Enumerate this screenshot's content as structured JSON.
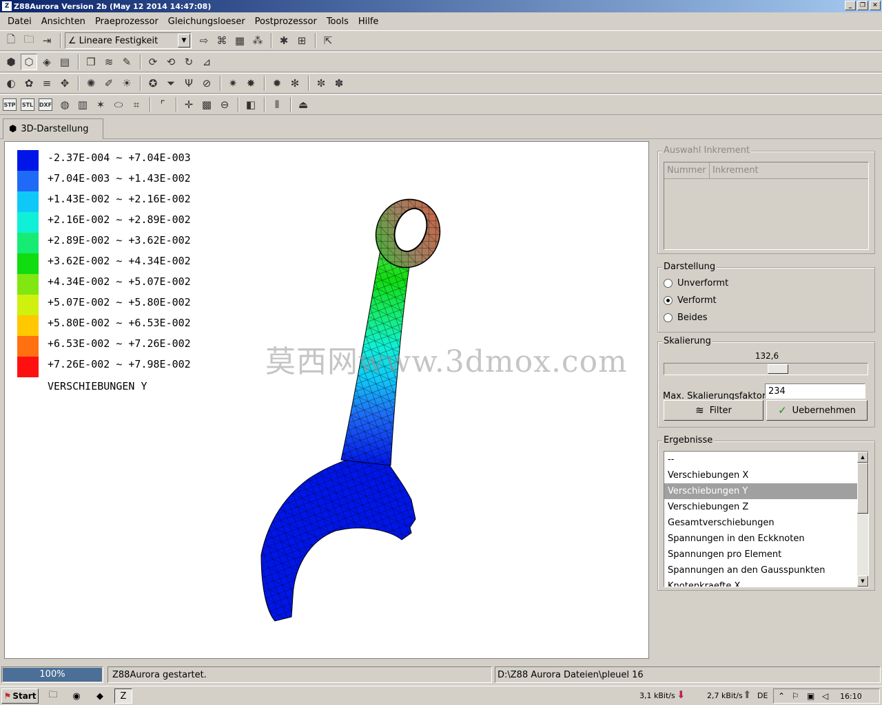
{
  "window": {
    "title": "Z88Aurora Version 2b (May 12 2014 14:47:08)",
    "app_icon": "Z",
    "minimize_glyph": "_",
    "restore_glyph": "❐",
    "close_glyph": "✕"
  },
  "menu": [
    "Datei",
    "Ansichten",
    "Praeprozessor",
    "Gleichungsloeser",
    "Postprozessor",
    "Tools",
    "Hilfe"
  ],
  "toolbar": {
    "analysis_type": "Lineare Festigkeit",
    "analysis_icon": "∠",
    "row1_left": [
      {
        "name": "new-file-icon",
        "glyph": "🗋"
      },
      {
        "name": "open-folder-icon",
        "glyph": "🗀"
      },
      {
        "name": "import-icon",
        "glyph": "⇥"
      }
    ],
    "row1_right": [
      {
        "name": "arrow-right-icon",
        "glyph": "⇨"
      },
      {
        "name": "mesh-icon",
        "glyph": "⌘"
      },
      {
        "name": "table-icon",
        "glyph": "▦"
      },
      {
        "name": "nodes-icon",
        "glyph": "⁂"
      },
      {
        "name": "bug-icon",
        "glyph": "✱"
      },
      {
        "name": "add-icon",
        "glyph": "⊞"
      },
      {
        "name": "exit-icon",
        "glyph": "⇱"
      }
    ],
    "row2": [
      {
        "name": "solid-view-icon",
        "glyph": "⬢"
      },
      {
        "name": "solid-mesh-view-icon",
        "glyph": "⬡",
        "active": true
      },
      {
        "name": "wireframe-view-icon",
        "glyph": "◈"
      },
      {
        "name": "surface-view-icon",
        "glyph": "▤"
      },
      {
        "name": "cube-icon",
        "glyph": "❒"
      },
      {
        "name": "layers-icon",
        "glyph": "≋"
      },
      {
        "name": "paint-icon",
        "glyph": "✎"
      },
      {
        "name": "rotate-x-icon",
        "glyph": "⟳"
      },
      {
        "name": "rotate-y-icon",
        "glyph": "⟲"
      },
      {
        "name": "rotate-z-icon",
        "glyph": "↻"
      },
      {
        "name": "axis-icon",
        "glyph": "⊿"
      }
    ],
    "row3": [
      {
        "name": "lighting-icon",
        "glyph": "◐"
      },
      {
        "name": "color-icon",
        "glyph": "✿"
      },
      {
        "name": "shading-icon",
        "glyph": "≡"
      },
      {
        "name": "move-icon",
        "glyph": "✥"
      },
      {
        "name": "materials-icon",
        "glyph": "✺"
      },
      {
        "name": "notes-icon",
        "glyph": "✐"
      },
      {
        "name": "light-bulb-icon",
        "glyph": "☀"
      },
      {
        "name": "constraints-icon",
        "glyph": "✪"
      },
      {
        "name": "filter-funnel-icon",
        "glyph": "⏷"
      },
      {
        "name": "branch-icon",
        "glyph": "Ψ"
      },
      {
        "name": "no-entry-icon",
        "glyph": "⊘"
      },
      {
        "name": "forces-icon",
        "glyph": "✷"
      },
      {
        "name": "pressure-icon",
        "glyph": "✸"
      },
      {
        "name": "loads-icon",
        "glyph": "✹"
      },
      {
        "name": "supports-icon",
        "glyph": "✻"
      },
      {
        "name": "springs-icon",
        "glyph": "✼"
      },
      {
        "name": "contacts-icon",
        "glyph": "✽"
      }
    ],
    "row4": [
      {
        "name": "import-stp-icon",
        "glyph": "STP"
      },
      {
        "name": "import-stl-icon",
        "glyph": "STL"
      },
      {
        "name": "import-dxf-icon",
        "glyph": "DXF"
      },
      {
        "name": "import-cad-icon",
        "glyph": "◍"
      },
      {
        "name": "calendar-icon",
        "glyph": "▥"
      },
      {
        "name": "mesher-icon",
        "glyph": "✶"
      },
      {
        "name": "shape-icon",
        "glyph": "⬭"
      },
      {
        "name": "grid-icon",
        "glyph": "⌗"
      },
      {
        "name": "line-tool-icon",
        "glyph": "⌜"
      },
      {
        "name": "axes-icon",
        "glyph": "✛"
      },
      {
        "name": "palette-icon",
        "glyph": "▩"
      },
      {
        "name": "section-icon",
        "glyph": "⊖"
      },
      {
        "name": "box-icon",
        "glyph": "◧"
      },
      {
        "name": "columns-icon",
        "glyph": "⦀"
      },
      {
        "name": "upload-icon",
        "glyph": "⏏"
      }
    ]
  },
  "tab": {
    "label": "3D-Darstellung",
    "icon": "⬢"
  },
  "legend": {
    "title": "VERSCHIEBUNGEN Y",
    "entries": [
      {
        "label": "-2.37E-004 ~ +7.04E-003",
        "color": "#0016e8"
      },
      {
        "label": "+7.04E-003 ~ +1.43E-002",
        "color": "#1f6af6"
      },
      {
        "label": "+1.43E-002 ~ +2.16E-002",
        "color": "#10c8f8"
      },
      {
        "label": "+2.16E-002 ~ +2.89E-002",
        "color": "#10f0d8"
      },
      {
        "label": "+2.89E-002 ~ +3.62E-002",
        "color": "#16ec74"
      },
      {
        "label": "+3.62E-002 ~ +4.34E-002",
        "color": "#10dc10"
      },
      {
        "label": "+4.34E-002 ~ +5.07E-002",
        "color": "#80e810"
      },
      {
        "label": "+5.07E-002 ~ +5.80E-002",
        "color": "#d0f010"
      },
      {
        "label": "+5.80E-002 ~ +6.53E-002",
        "color": "#ffc800"
      },
      {
        "label": "+6.53E-002 ~ +7.26E-002",
        "color": "#ff7010"
      },
      {
        "label": "+7.26E-002 ~ +7.98E-002",
        "color": "#ff1010"
      }
    ]
  },
  "watermark": "莫西网www.3dmox.com",
  "panel": {
    "increment": {
      "title": "Auswahl Inkrement",
      "columns": [
        "Nummer",
        "Inkrement"
      ]
    },
    "display": {
      "title": "Darstellung",
      "options": [
        "Unverformt",
        "Verformt",
        "Beides"
      ],
      "selected_index": 1
    },
    "scaling": {
      "title": "Skalierung",
      "value": "132,6",
      "slider_fraction": 0.566,
      "max_label": "Max. Skalierungsfaktor",
      "max_value": "234",
      "filter_label": "Filter",
      "filter_icon": "≋",
      "apply_label": "Uebernehmen",
      "apply_icon": "✓"
    },
    "results": {
      "title": "Ergebnisse",
      "items": [
        "--",
        "Verschiebungen X",
        "Verschiebungen Y",
        "Verschiebungen Z",
        "Gesamtverschiebungen",
        "Spannungen in den Eckknoten",
        "Spannungen pro Element",
        "Spannungen an den Gausspunkten",
        "Knotenkraefte X"
      ],
      "selected_index": 2,
      "scroll_up": "▲",
      "scroll_down": "▼"
    }
  },
  "status": {
    "progress_text": "100%",
    "progress_fraction": 1.0,
    "message": "Z88Aurora gestartet.",
    "path": "D:\\Z88 Aurora Dateien\\pleuel 16"
  },
  "taskbar": {
    "start_label": "Start",
    "start_icon": "⚑",
    "apps": [
      {
        "name": "explorer-icon",
        "glyph": "🗀"
      },
      {
        "name": "firefox-icon",
        "glyph": "◉"
      },
      {
        "name": "app-icon",
        "glyph": "◆"
      },
      {
        "name": "z88-icon",
        "glyph": "Z",
        "pressed": true
      }
    ],
    "download_rate": "3,1 kBit/s",
    "upload_rate": "2,7 kBit/s",
    "language": "DE",
    "clock": "16:10",
    "down_arrow": "⬇",
    "up_arrow": "⬆",
    "tray_chevron": "⌃",
    "tray_icons": [
      {
        "name": "flag-icon",
        "glyph": "⚐"
      },
      {
        "name": "network-icon",
        "glyph": "▣"
      },
      {
        "name": "volume-icon",
        "glyph": "◁"
      }
    ]
  }
}
